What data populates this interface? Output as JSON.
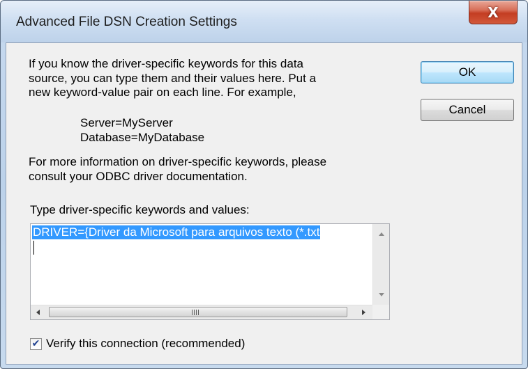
{
  "window": {
    "title": "Advanced File DSN Creation Settings",
    "close_glyph": "X"
  },
  "description": {
    "line1": "If you know the driver-specific keywords for this data",
    "line2": "source, you can type them and their values here.  Put a",
    "line3": "new keyword-value pair on each line.  For example,"
  },
  "example": {
    "line1": "Server=MyServer",
    "line2": "Database=MyDatabase"
  },
  "more_info": {
    "line1": "For more information on driver-specific keywords, please",
    "line2": "consult your ODBC driver documentation."
  },
  "keywords": {
    "label": "Type driver-specific keywords and values:",
    "value": "DRIVER={Driver da Microsoft para arquivos texto (*.txt"
  },
  "buttons": {
    "ok": "OK",
    "cancel": "Cancel"
  },
  "verify": {
    "label": "Verify this connection (recommended)",
    "checked": true,
    "check_glyph": "✔"
  },
  "colors": {
    "selection": "#3399ff",
    "close_button": "#c43d22"
  }
}
